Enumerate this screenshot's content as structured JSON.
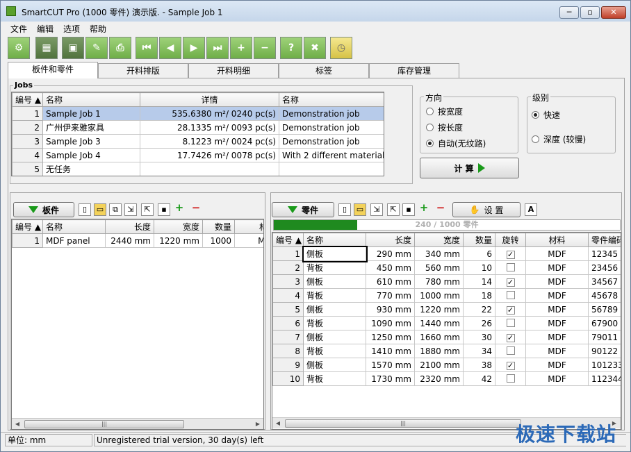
{
  "window": {
    "title": "SmartCUT Pro (1000 零件) 演示版. - Sample Job 1",
    "min": "─",
    "max": "▫",
    "close": "✕"
  },
  "menu": [
    "文件",
    "编辑",
    "选项",
    "帮助"
  ],
  "toolbar_icons": [
    "gear-icon",
    "calculator-icon",
    "save-icon",
    "edit-icon",
    "print-icon",
    "first-icon",
    "prev-icon",
    "next-icon",
    "last-icon",
    "add-icon",
    "remove-icon",
    "help-icon",
    "exit-icon",
    "clock-icon"
  ],
  "tabs": [
    "板件和零件",
    "开料排版",
    "开料明细",
    "标签",
    "库存管理"
  ],
  "jobs": {
    "title": "Jobs",
    "headers": [
      "编号",
      "名称",
      "详情",
      "名称"
    ],
    "rows": [
      {
        "n": "1",
        "name": "Sample Job 1",
        "detail": "535.6380 m²/ 0240 pc(s)",
        "desc": "Demonstration job",
        "selected": true
      },
      {
        "n": "2",
        "name": "广州伊来雅家具",
        "detail": "28.1335 m²/ 0093 pc(s)",
        "desc": "Demonstration job",
        "selected": false
      },
      {
        "n": "3",
        "name": "Sample Job 3",
        "detail": "8.1223 m²/ 0024 pc(s)",
        "desc": "Demonstration job",
        "selected": false
      },
      {
        "n": "4",
        "name": "Sample Job 4",
        "detail": "17.7426 m²/ 0078 pc(s)",
        "desc": "With 2 different material ...",
        "selected": false
      },
      {
        "n": "5",
        "name": "无任务",
        "detail": "",
        "desc": "",
        "selected": false
      }
    ]
  },
  "direction": {
    "title": "方向",
    "options": [
      "按宽度",
      "按长度",
      "自动(无纹路)"
    ],
    "selected": 2
  },
  "level": {
    "title": "级别",
    "options": [
      "快速",
      "深度 (较慢)"
    ],
    "selected": 0
  },
  "calc_button": "计 算",
  "boards": {
    "button": "板件",
    "headers": [
      "编号",
      "名称",
      "长度",
      "宽度",
      "数量",
      "材"
    ],
    "rows": [
      {
        "n": "1",
        "name": "MDF panel",
        "len": "2440 mm",
        "wid": "1220 mm",
        "qty": "1000",
        "mat": "MI"
      }
    ]
  },
  "parts": {
    "button": "零件",
    "settings_button": "设 置",
    "progress_text": "240 / 1000 零件",
    "progress_value": 0.24,
    "headers": [
      "编号",
      "名称",
      "长度",
      "宽度",
      "数量",
      "旋转",
      "材料",
      "零件编码"
    ],
    "rows": [
      {
        "n": "1",
        "name": "侧板",
        "len": "290 mm",
        "wid": "340 mm",
        "qty": "6",
        "rot": true,
        "mat": "MDF",
        "code": "12345"
      },
      {
        "n": "2",
        "name": "背板",
        "len": "450 mm",
        "wid": "560 mm",
        "qty": "10",
        "rot": false,
        "mat": "MDF",
        "code": "23456"
      },
      {
        "n": "3",
        "name": "侧板",
        "len": "610 mm",
        "wid": "780 mm",
        "qty": "14",
        "rot": true,
        "mat": "MDF",
        "code": "34567"
      },
      {
        "n": "4",
        "name": "背板",
        "len": "770 mm",
        "wid": "1000 mm",
        "qty": "18",
        "rot": false,
        "mat": "MDF",
        "code": "45678"
      },
      {
        "n": "5",
        "name": "侧板",
        "len": "930 mm",
        "wid": "1220 mm",
        "qty": "22",
        "rot": true,
        "mat": "MDF",
        "code": "56789"
      },
      {
        "n": "6",
        "name": "背板",
        "len": "1090 mm",
        "wid": "1440 mm",
        "qty": "26",
        "rot": false,
        "mat": "MDF",
        "code": "67900"
      },
      {
        "n": "7",
        "name": "侧板",
        "len": "1250 mm",
        "wid": "1660 mm",
        "qty": "30",
        "rot": true,
        "mat": "MDF",
        "code": "79011"
      },
      {
        "n": "8",
        "name": "背板",
        "len": "1410 mm",
        "wid": "1880 mm",
        "qty": "34",
        "rot": false,
        "mat": "MDF",
        "code": "90122"
      },
      {
        "n": "9",
        "name": "侧板",
        "len": "1570 mm",
        "wid": "2100 mm",
        "qty": "38",
        "rot": true,
        "mat": "MDF",
        "code": "101233"
      },
      {
        "n": "10",
        "name": "背板",
        "len": "1730 mm",
        "wid": "2320 mm",
        "qty": "42",
        "rot": false,
        "mat": "MDF",
        "code": "112344"
      }
    ]
  },
  "status": {
    "unit": "单位: mm",
    "message": "Unregistered trial version, 30 day(s) left"
  },
  "watermark": "极速下载站",
  "colors": {
    "accent": "#1a9a1a",
    "selection": "#b7cbea",
    "progress": "#1f8a1f"
  }
}
